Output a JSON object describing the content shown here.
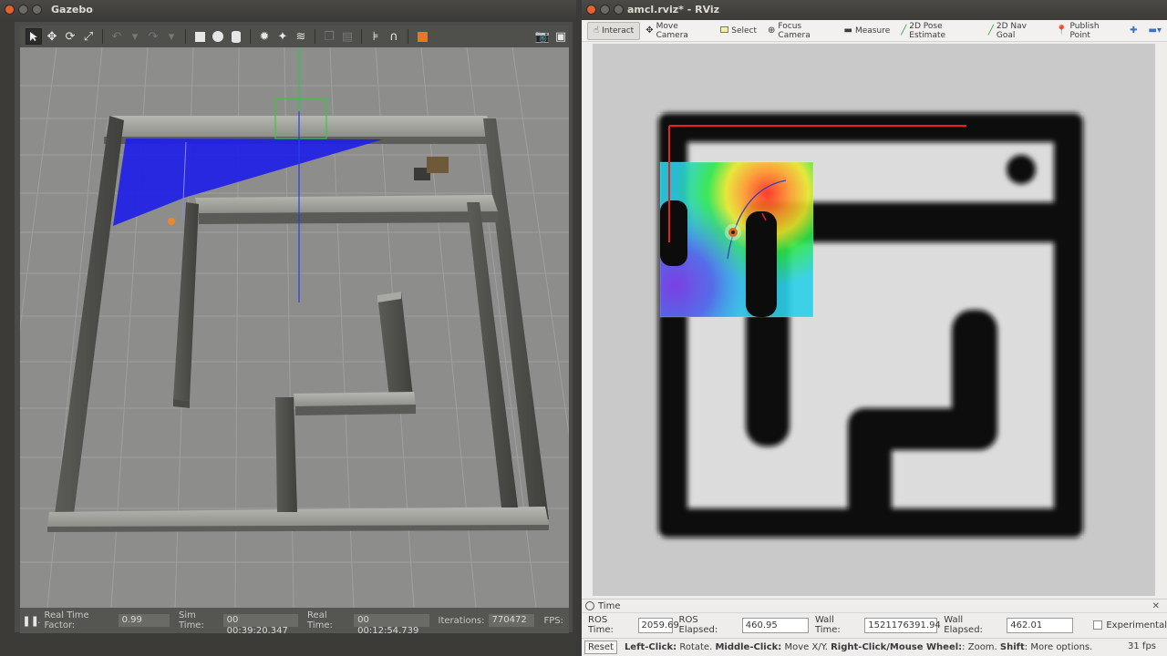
{
  "gazebo": {
    "window_title": "Gazebo",
    "toolbar": [
      "select-arrow-icon",
      "translate-icon",
      "rotate-icon",
      "scale-icon",
      "undo-icon",
      "redo-icon",
      "box-icon",
      "sphere-icon",
      "cylinder-icon",
      "point-light-icon",
      "spot-light-icon",
      "directional-light-icon",
      "copy-icon",
      "paste-icon",
      "align-icon",
      "snap-icon",
      "orange-model-icon",
      "camera-icon",
      "record-icon"
    ],
    "status": {
      "rtf_label": "Real Time Factor:",
      "rtf_value": "0.99",
      "sim_label": "Sim Time:",
      "sim_value": "00 00:39:20.347",
      "real_label": "Real Time:",
      "real_value": "00 00:12:54.739",
      "iter_label": "Iterations:",
      "iter_value": "770472",
      "fps_label": "FPS:"
    }
  },
  "rviz": {
    "window_title": "amcl.rviz* - RViz",
    "tools": {
      "interact": "Interact",
      "move_camera": "Move Camera",
      "select": "Select",
      "focus_camera": "Focus Camera",
      "measure": "Measure",
      "pose_estimate": "2D Pose Estimate",
      "nav_goal": "2D Nav Goal",
      "publish_point": "Publish Point"
    },
    "time_panel": {
      "title": "Time",
      "ros_time_label": "ROS Time:",
      "ros_time": "2059.69",
      "ros_elapsed_label": "ROS Elapsed:",
      "ros_elapsed": "460.95",
      "wall_time_label": "Wall Time:",
      "wall_time": "1521176391.94",
      "wall_elapsed_label": "Wall Elapsed:",
      "wall_elapsed": "462.01",
      "experimental_label": "Experimental"
    },
    "status": {
      "reset": "Reset",
      "hint_left_key": "Left-Click:",
      "hint_left": " Rotate. ",
      "hint_middle_key": "Middle-Click:",
      "hint_middle": " Move X/Y. ",
      "hint_right_key": "Right-Click/Mouse Wheel:",
      "hint_right": ": Zoom. ",
      "hint_shift_key": "Shift",
      "hint_shift": ": More options.",
      "fps": "31 fps"
    }
  }
}
